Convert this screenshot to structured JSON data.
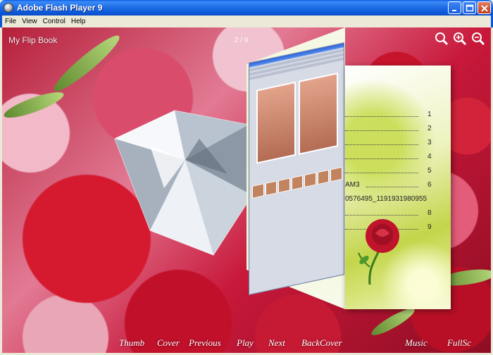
{
  "window": {
    "title": "Adobe Flash Player 9"
  },
  "menu": [
    "File",
    "View",
    "Control",
    "Help"
  ],
  "flipbook": {
    "title": "My Flip Book",
    "page_counter": "2 / 9",
    "toc": [
      {
        "name": "",
        "page": "1"
      },
      {
        "name": "",
        "page": "2"
      },
      {
        "name": "",
        "page": "3"
      },
      {
        "name": "",
        "page": "4"
      },
      {
        "name": "",
        "page": "5"
      },
      {
        "name": "AM3",
        "page": "6"
      },
      {
        "name": "0576495_1191931980955",
        "page": ""
      },
      {
        "name": "",
        "page": "8"
      },
      {
        "name": "",
        "page": "9"
      }
    ]
  },
  "zoom_tools": [
    "search-icon",
    "zoom-in-icon",
    "zoom-out-icon"
  ],
  "bottom_nav": {
    "thumb": "Thumb",
    "cover": "Cover",
    "previous": "Previous",
    "play": "Play",
    "next": "Next",
    "backcover": "BackCover",
    "music": "Music",
    "fullscreen": "FullSc"
  },
  "colors": {
    "titlebar": "#0b56d8",
    "menubar": "#ece9d8",
    "rose_red": "#c6142c",
    "page_green": "#c3d54a"
  }
}
